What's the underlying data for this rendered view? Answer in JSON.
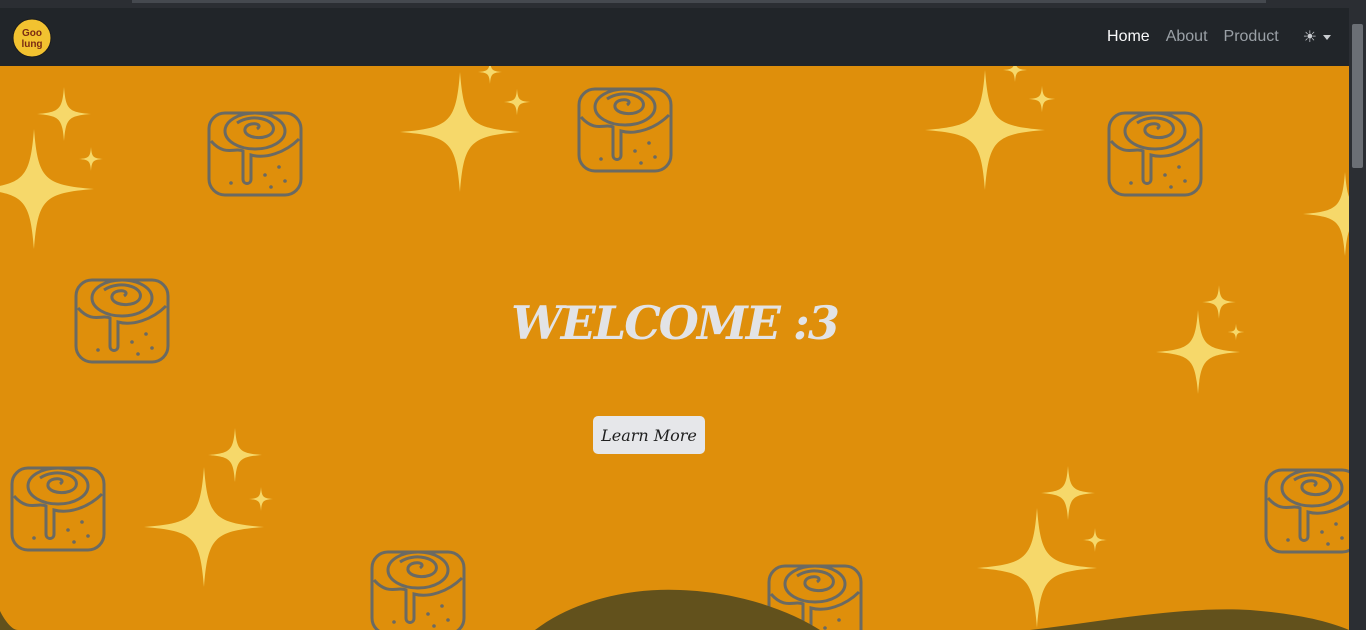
{
  "navbar": {
    "logo_text_top": "Goo",
    "logo_text_bottom": "lung",
    "links": [
      {
        "label": "Home",
        "active": true
      },
      {
        "label": "About",
        "active": false
      },
      {
        "label": "Product",
        "active": false
      }
    ],
    "theme_icon": "☀"
  },
  "hero": {
    "title": "WELCOME :3",
    "button_label": "Learn More"
  },
  "colors": {
    "navbar_bg": "#212529",
    "hero_bg": "#df8f0b",
    "sparkle": "#f6d86a",
    "roll_stroke": "#6a6a63",
    "hill": "#62511c"
  }
}
